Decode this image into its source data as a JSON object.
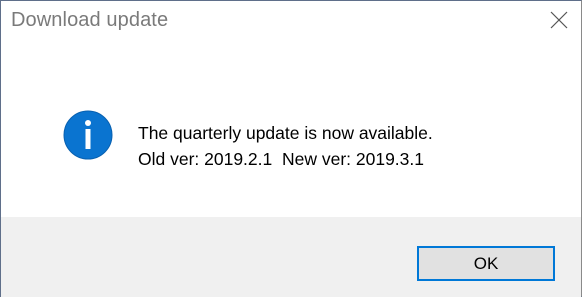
{
  "dialog": {
    "title": "Download update",
    "close_icon": "close-icon",
    "message_icon": "info-icon",
    "message_line1": "The quarterly update is now available.",
    "message_line2": "Old ver: 2019.2.1  New ver: 2019.3.1",
    "ok_label": "OK"
  },
  "colors": {
    "icon_blue": "#0a74d0",
    "button_focus": "#0078d7",
    "footer_bg": "#f0f0f0"
  }
}
